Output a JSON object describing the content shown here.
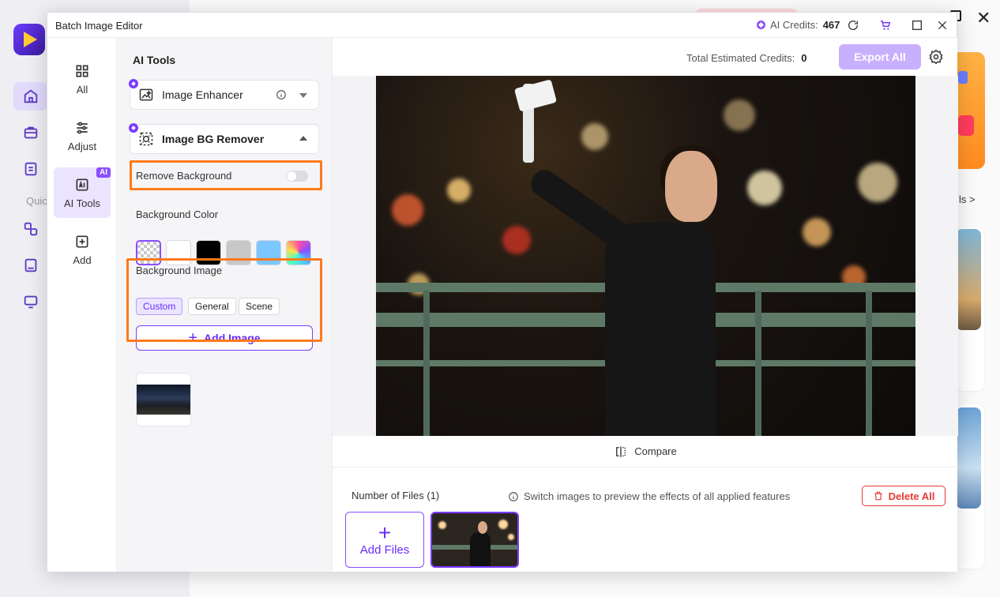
{
  "window": {
    "title": "Batch Image Editor"
  },
  "credits": {
    "label": "AI Credits:",
    "value": "467"
  },
  "nav": {
    "items": [
      {
        "label": "All",
        "icon": "grid-icon"
      },
      {
        "label": "Adjust",
        "icon": "sliders-icon"
      },
      {
        "label": "AI Tools",
        "icon": "ai-tools-icon",
        "badge": "AI",
        "active": true
      },
      {
        "label": "Add",
        "icon": "plus-square-icon"
      }
    ]
  },
  "panel": {
    "title": "AI Tools",
    "enhancer": {
      "label": "Image Enhancer"
    },
    "bg_remover": {
      "label": "Image BG Remover",
      "remove_background": {
        "label": "Remove Background",
        "enabled": false
      },
      "background_color": {
        "label": "Background Color",
        "swatches": [
          "transparent",
          "#ffffff",
          "#000000",
          "#c8c8c8",
          "#7cc7ff",
          "gradient"
        ]
      },
      "background_image": {
        "label": "Background Image",
        "tabs": [
          "Custom",
          "General",
          "Scene"
        ],
        "active_tab": "Custom",
        "add_button": "Add Image"
      }
    }
  },
  "toolbar": {
    "estimated_label": "Total Estimated Credits:",
    "estimated_value": "0",
    "export_label": "Export All"
  },
  "preview": {
    "compare_label": "Compare"
  },
  "files": {
    "count_label": "Number of Files (1)",
    "hint": "Switch images to preview the effects of all applied features",
    "delete_label": "Delete All",
    "add_label": "Add Files"
  },
  "background_app": {
    "quick_label": "Quic",
    "link_label": "ls >"
  },
  "colors": {
    "accent": "#7b3bff",
    "highlight": "#ff7a1a",
    "danger": "#e53935"
  }
}
